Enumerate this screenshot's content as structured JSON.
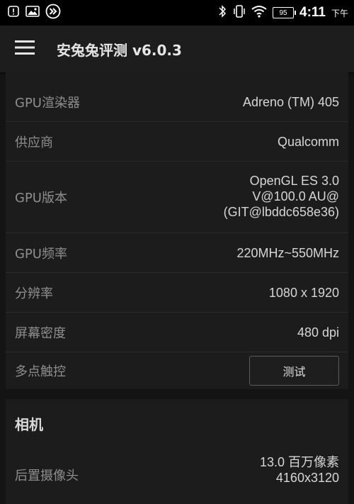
{
  "status_bar": {
    "time": "4:11",
    "ampm": "下午",
    "battery": "95",
    "icons": [
      "notification-alert-icon",
      "image-icon",
      "fast-forward-icon",
      "bluetooth-muted-icon",
      "vibrate-icon",
      "wifi-icon",
      "battery-icon"
    ]
  },
  "toolbar": {
    "title": "安兔兔评测 v6.0.3",
    "menu_icon": "hamburger-menu-icon"
  },
  "gpu_card": {
    "rows": [
      {
        "label": "GPU渲染器",
        "value": "Adreno (TM) 405"
      },
      {
        "label": "供应商",
        "value": "Qualcomm"
      },
      {
        "label": "GPU版本",
        "value_lines": [
          "OpenGL ES 3.0",
          "V@100.0 AU@",
          "(GIT@lbddc658e36)"
        ]
      },
      {
        "label": "GPU频率",
        "value": "220MHz~550MHz"
      },
      {
        "label": "分辨率",
        "value": "1080 x 1920"
      },
      {
        "label": "屏幕密度",
        "value": "480 dpi"
      },
      {
        "label": "多点触控",
        "button": "测试"
      }
    ]
  },
  "camera_card": {
    "title": "相机",
    "rows": [
      {
        "label": "后置摄像头",
        "value_lines": [
          "13.0 百万像素",
          "4160x3120"
        ]
      }
    ]
  },
  "colors": {
    "background": "#141414",
    "card": "#1c1c1c",
    "toolbar": "#1d1d1d",
    "label": "#8e8e8e",
    "value": "#d6d6d6"
  }
}
